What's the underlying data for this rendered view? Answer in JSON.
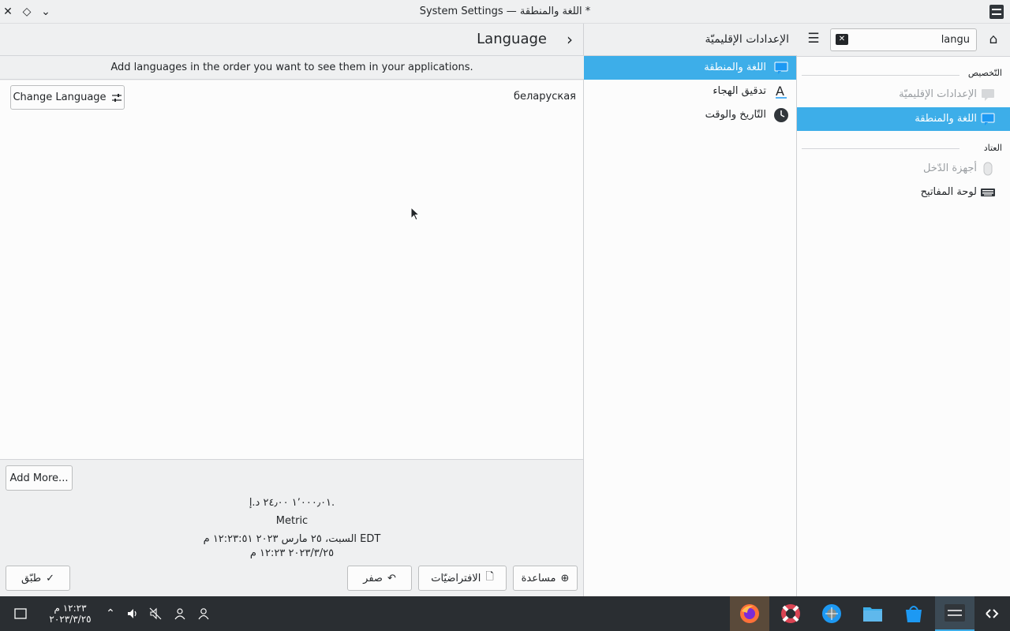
{
  "window": {
    "title": "System Settings — اللغة والمنطقة *"
  },
  "content": {
    "page_title": "Language",
    "hint": "Add languages in the order you want to see them in your applications.",
    "languages": [
      "беларуская"
    ],
    "change_language_label": "Change Language",
    "add_more_label": "Add More...",
    "summary": {
      "currency": "١٬٠٠٠٫٠١ ٢٤٫٠٠ د.إ.",
      "measurement": "Metric",
      "long_date": "السبت، ٢٥ مارس ٢٠٢٣ ١٢:٢٣:٥١ م EDT",
      "short_date": "٢٠٢٣/٣/٢٥ ١٢:٢٣ م"
    },
    "buttons": {
      "apply": "طبّق",
      "reset": "صفر",
      "defaults": "الافتراضيّات",
      "help": "مساعدة"
    }
  },
  "middle": {
    "title": "الإعدادات الإقليميّة",
    "items": [
      {
        "label": "اللغة والمنطقة",
        "icon": "region-icon",
        "selected": true
      },
      {
        "label": "تدقيق الهجاء",
        "icon": "spellcheck-icon",
        "selected": false
      },
      {
        "label": "التّاريخ والوقت",
        "icon": "clock-icon",
        "selected": false
      }
    ]
  },
  "sidebar": {
    "search_value": "langu",
    "sections": [
      {
        "title": "التّخصيص",
        "items": [
          {
            "label": "الإعدادات الإقليميّة",
            "icon": "regional-settings-icon",
            "dimmed": true
          },
          {
            "label": "اللغة والمنطقة",
            "icon": "region-icon",
            "selected": true
          }
        ]
      },
      {
        "title": "العتاد",
        "items": [
          {
            "label": "أجهزة الدّخل",
            "icon": "mouse-icon",
            "dimmed": true
          },
          {
            "label": "لوحة المفاتيح",
            "icon": "keyboard-icon",
            "dimmed": false
          }
        ]
      }
    ]
  },
  "taskbar": {
    "time": "١٢:٢٣ م",
    "date": "٢٠٢٣/٣/٢٥",
    "apps": [
      "firefox-icon",
      "help-lifebuoy-icon",
      "system-settings-globe-icon",
      "file-manager-icon",
      "discover-store-icon",
      "system-settings-icon"
    ]
  },
  "colors": {
    "accent": "#3daee9",
    "taskbar": "#2a2e32",
    "window_bg": "#eff0f1",
    "view_bg": "#fcfcfc"
  }
}
